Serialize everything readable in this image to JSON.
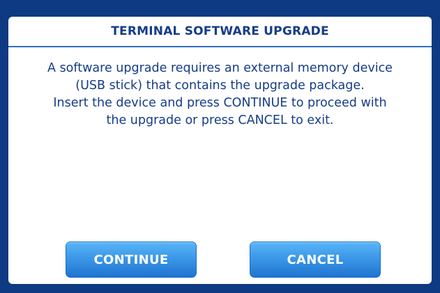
{
  "dialog": {
    "title": "TERMINAL SOFTWARE UPGRADE",
    "message_lines": [
      "A software upgrade requires an external memory device",
      "(USB stick) that contains the upgrade package.",
      "Insert the device and press CONTINUE to proceed with",
      "the upgrade or press CANCEL to exit."
    ]
  },
  "buttons": {
    "continue_label": "CONTINUE",
    "cancel_label": "CANCEL"
  },
  "colors": {
    "background": "#0d3a82",
    "text": "#163c87",
    "button": "#3c98e8"
  }
}
